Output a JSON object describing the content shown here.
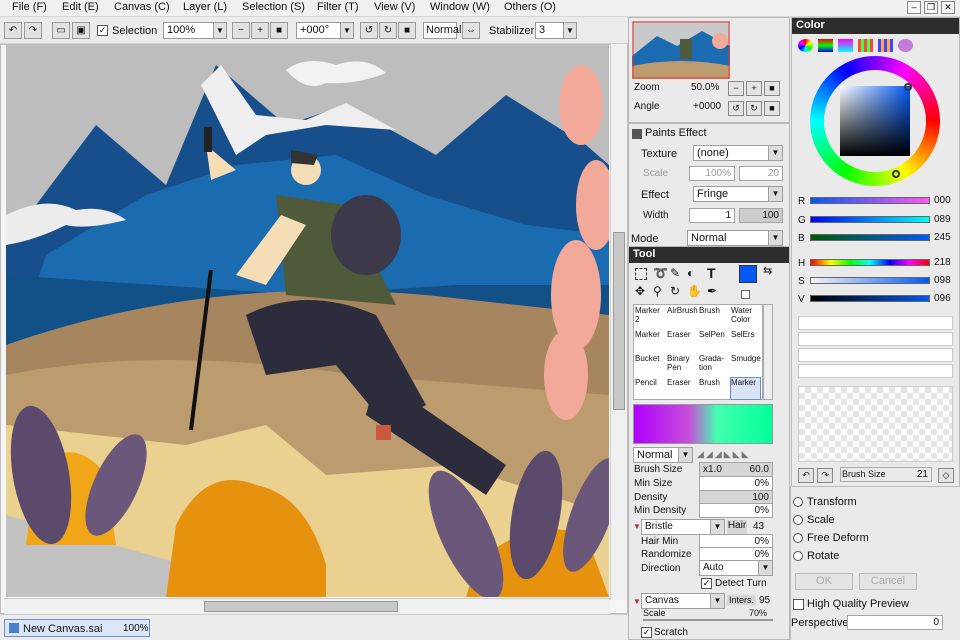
{
  "menu": {
    "items": [
      "File (F)",
      "Edit (E)",
      "Canvas (C)",
      "Layer (L)",
      "Selection (S)",
      "Filter (T)",
      "View (V)",
      "Window (W)",
      "Others (O)"
    ],
    "window_buttons": [
      "–",
      "❐",
      "✕"
    ]
  },
  "toolbar": {
    "selection_label": "Selection",
    "selection_checked": "✓",
    "zoom": "100%",
    "angle": "+000°",
    "blend": "Normal",
    "stabilizer_label": "Stabilizer",
    "stabilizer_value": "3"
  },
  "navigator": {
    "zoom_label": "Zoom",
    "zoom_value": "50.0%",
    "angle_label": "Angle",
    "angle_value": "+0000"
  },
  "paint_effect": {
    "title": "Paints Effect",
    "texture_label": "Texture",
    "texture_value": "(none)",
    "scale_label": "Scale",
    "scale_value": "100%",
    "scale_num": "20",
    "effect_label": "Effect",
    "effect_value": "Fringe",
    "width_label": "Width",
    "width_value": "1",
    "width_num": "100",
    "mode_label": "Mode",
    "mode_value": "Normal"
  },
  "tool_panel": {
    "title": "Tool",
    "brushes": [
      [
        "Marker 2",
        "AirBrush",
        "Brush",
        "Water Color"
      ],
      [
        "Marker",
        "Eraser",
        "SelPen",
        "SelErs"
      ],
      [
        "Bucket",
        "Binary Pen",
        "Grada-tion",
        "Smudge"
      ],
      [
        "Pencil",
        "Eraser",
        "Brush",
        "Marker"
      ]
    ],
    "blend_mode": "Normal",
    "brush_size_label": "Brush Size",
    "brush_size_mult": "x1.0",
    "brush_size_value": "60.0",
    "min_size_label": "Min Size",
    "min_size_value": "0%",
    "density_label": "Density",
    "density_value": "100",
    "min_density_label": "Min Density",
    "min_density_value": "0%",
    "bristle_label": "Bristle",
    "hair_label": "Hair",
    "hair_value": "43",
    "hair_min_label": "Hair Min",
    "hair_min_value": "0%",
    "randomize_label": "Randomize",
    "randomize_value": "0%",
    "direction_label": "Direction",
    "direction_value": "Auto",
    "detect_turn_label": "Detect Turn",
    "canvas_label": "Canvas",
    "inters_label": "Inters.",
    "inters_value": "95",
    "scale2_label": "Scale",
    "scale2_value": "70%",
    "scratch_label": "Scratch"
  },
  "color_panel": {
    "title": "Color",
    "r_label": "R",
    "r_value": "000",
    "g_label": "G",
    "g_value": "089",
    "b_label": "B",
    "b_value": "245",
    "h_label": "H",
    "h_value": "218",
    "s_label": "S",
    "s_value": "098",
    "v_label": "V",
    "v_value": "096",
    "brush_size_label": "Brush Size",
    "brush_size_value": "21",
    "current_color": "#0059f5"
  },
  "transform_panel": {
    "options": [
      "Transform",
      "Scale",
      "Free Deform",
      "Rotate"
    ],
    "ok_label": "OK",
    "cancel_label": "Cancel",
    "hq_preview_label": "High Quality Preview",
    "perspective_label": "Perspective",
    "perspective_value": "0"
  },
  "taskbar": {
    "doc_name": "New Canvas.sai",
    "doc_zoom": "100%"
  }
}
